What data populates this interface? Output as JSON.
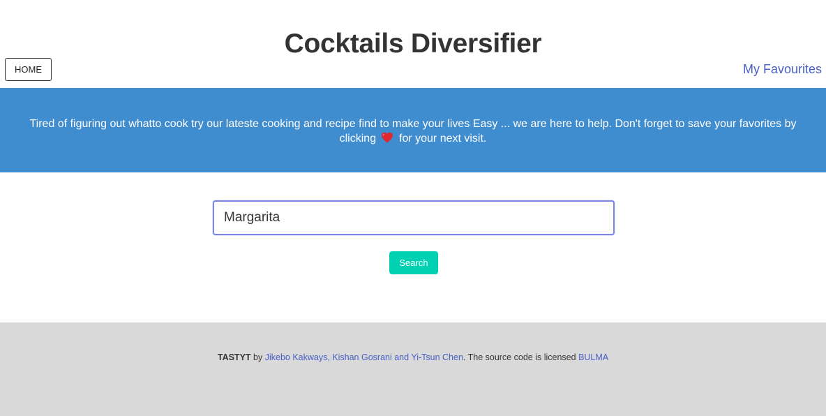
{
  "header": {
    "title": "Cocktails Diversifier",
    "home_label": "HOME",
    "favourites_label": "My Favourites"
  },
  "banner": {
    "text_before_heart": "Tired of figuring out whatto cook try our lateste cooking and recipe find to make your lives Easy ... we are here to help. Don't forget to save your favorites by clicking",
    "text_after_heart": "for your next visit.",
    "heart_icon": "heart-icon",
    "background_color": "#3f8ccf"
  },
  "search": {
    "value": "Margarita",
    "button_label": "Search",
    "button_color": "#00d1b2"
  },
  "footer": {
    "brand": "TASTYT",
    "by": "by",
    "authors_link": "Jikebo Kakways, Kishan Gosrani and Yi-Tsun Chen",
    "license_text": ". The source code is licensed",
    "license_link": "BULMA",
    "background_color": "#d9d9d9"
  }
}
